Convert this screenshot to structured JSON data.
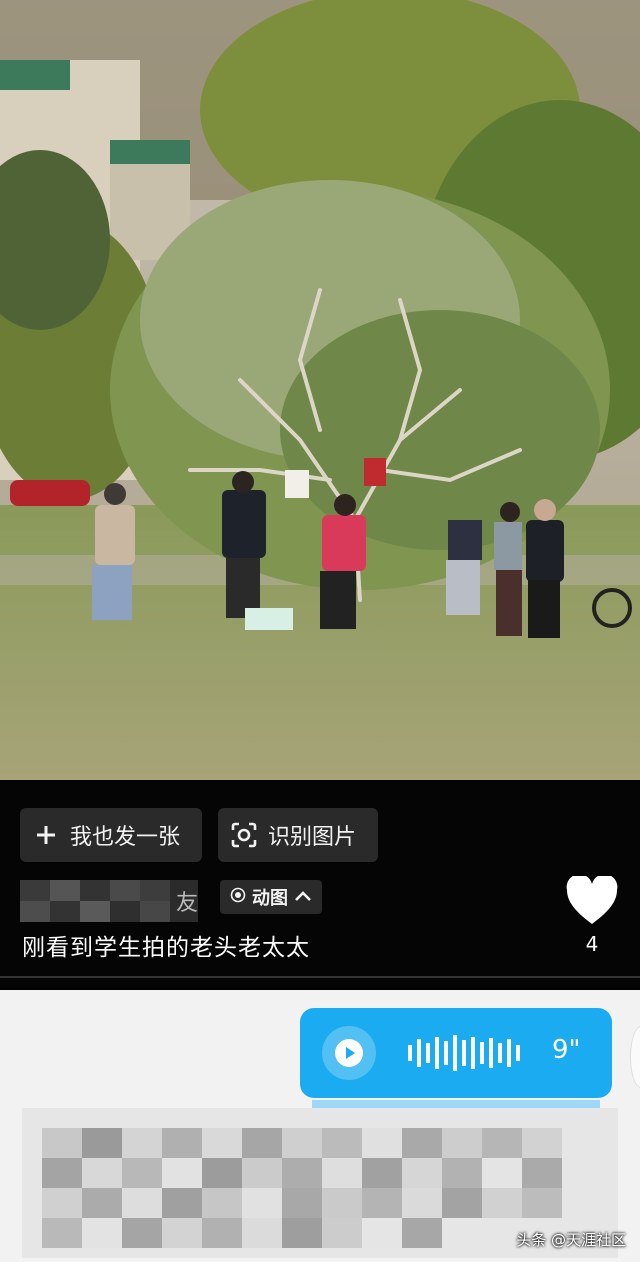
{
  "photo": {
    "icon": "photo-scene"
  },
  "actions": {
    "post_too": {
      "icon": "plus-icon",
      "label": "我也发一张"
    },
    "identify": {
      "icon": "scan-icon",
      "label": "识别图片"
    }
  },
  "post": {
    "author_tail": "友",
    "tag_label": "动图",
    "caption": "刚看到学生拍的老头老太太"
  },
  "like": {
    "icon": "heart-icon",
    "count": "4"
  },
  "voice_message": {
    "duration": "9\"",
    "accent": "#1aabf0"
  },
  "watermark": "头条 @天涯社区"
}
